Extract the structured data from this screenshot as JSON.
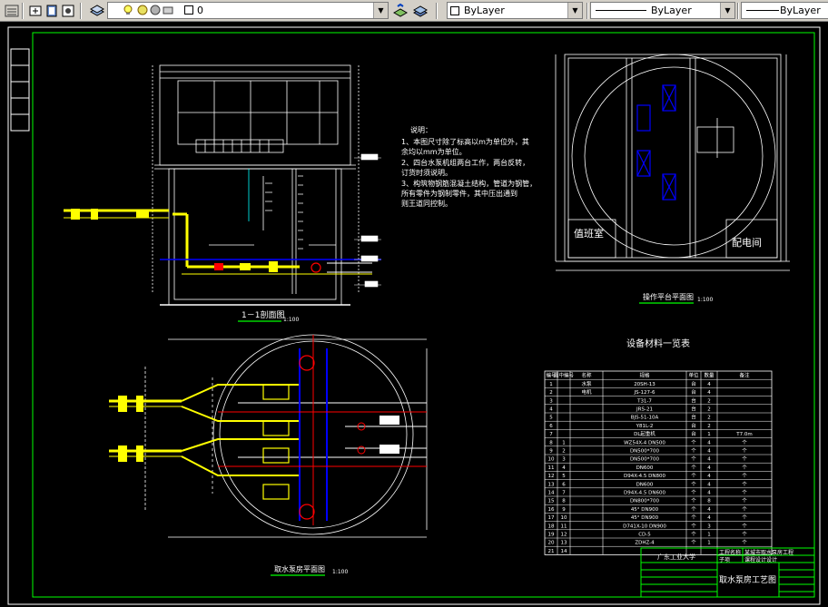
{
  "toolbar": {
    "layer_value": "0",
    "color_value": "ByLayer",
    "linetype_value": "ByLayer",
    "lineweight_value": "ByLayer",
    "icons": [
      "layer-manager-icon",
      "layer-previous-icon",
      "layers-icon",
      "lightbulb-icon",
      "sun-icon",
      "lock-icon",
      "make-object-layer-current-icon",
      "layer-previous-icon",
      "color-swatch-icon"
    ]
  },
  "drawing": {
    "section_title": "1－1剖面图",
    "section_scale": "1:100",
    "plan_title": "取水泵房平面图",
    "plan_scale": "1:100",
    "platform_title": "操作平台平面图",
    "platform_scale": "1:100",
    "room_duty": "值班室",
    "room_power": "配电间",
    "notes_title": "说明：",
    "notes": [
      "1、本图尺寸除了标高以m为单位外，其",
      "   余均以mm为单位。",
      "2、四台水泵机组两台工作，两台反转，",
      "   订货时须说明。",
      "3、构筑物钢筋混凝土结构，管道为钢管，",
      "   所有零件为钢制零件，其中压出通到",
      "   则王道同控制。"
    ],
    "table_title": "设备材料一览表",
    "table_headers": [
      "编号",
      "图中编号",
      "名称",
      "规格",
      "单位",
      "数量",
      "备注"
    ],
    "table_rows": [
      {
        "no": "1",
        "ref": "",
        "name": "水泵",
        "spec": "20SH-13",
        "unit": "台",
        "qty": "4",
        "note": ""
      },
      {
        "no": "2",
        "ref": "",
        "name": "电机",
        "spec": "JS-127-6",
        "unit": "台",
        "qty": "4",
        "note": ""
      },
      {
        "no": "3",
        "ref": "",
        "name": "",
        "spec": "T31-7",
        "unit": "台",
        "qty": "2",
        "note": ""
      },
      {
        "no": "4",
        "ref": "",
        "name": "",
        "spec": "JRS-21",
        "unit": "台",
        "qty": "2",
        "note": ""
      },
      {
        "no": "5",
        "ref": "",
        "name": "",
        "spec": "BJS-51-10A",
        "unit": "台",
        "qty": "2",
        "note": ""
      },
      {
        "no": "6",
        "ref": "",
        "name": "",
        "spec": "Y81L-2",
        "unit": "台",
        "qty": "2",
        "note": ""
      },
      {
        "no": "7",
        "ref": "",
        "name": "",
        "spec": "DL起重机",
        "unit": "台",
        "qty": "1",
        "note": "T7.0m"
      },
      {
        "no": "8",
        "ref": "1",
        "name": "",
        "spec": "WZ54X-4 DN500",
        "unit": "个",
        "qty": "4",
        "note": "个"
      },
      {
        "no": "9",
        "ref": "2",
        "name": "",
        "spec": "DN500*700",
        "unit": "个",
        "qty": "4",
        "note": "个"
      },
      {
        "no": "10",
        "ref": "3",
        "name": "",
        "spec": "DN500*700",
        "unit": "个",
        "qty": "4",
        "note": "个"
      },
      {
        "no": "11",
        "ref": "4",
        "name": "",
        "spec": "DN600",
        "unit": "个",
        "qty": "4",
        "note": "个"
      },
      {
        "no": "12",
        "ref": "5",
        "name": "",
        "spec": "D94X-4.5 DN800",
        "unit": "个",
        "qty": "4",
        "note": "个"
      },
      {
        "no": "13",
        "ref": "6",
        "name": "",
        "spec": "DN600",
        "unit": "个",
        "qty": "4",
        "note": "个"
      },
      {
        "no": "14",
        "ref": "7",
        "name": "",
        "spec": "D94X-4.5 DN600",
        "unit": "个",
        "qty": "4",
        "note": "个"
      },
      {
        "no": "15",
        "ref": "8",
        "name": "",
        "spec": "DN800*700",
        "unit": "个",
        "qty": "8",
        "note": "个"
      },
      {
        "no": "16",
        "ref": "9",
        "name": "",
        "spec": "45° DN900",
        "unit": "个",
        "qty": "4",
        "note": "个"
      },
      {
        "no": "17",
        "ref": "10",
        "name": "",
        "spec": "45° DN900",
        "unit": "个",
        "qty": "4",
        "note": "个"
      },
      {
        "no": "18",
        "ref": "11",
        "name": "",
        "spec": "D741X-10 DN900",
        "unit": "个",
        "qty": "3",
        "note": "个"
      },
      {
        "no": "19",
        "ref": "12",
        "name": "",
        "spec": "CD-5",
        "unit": "个",
        "qty": "1",
        "note": "个"
      },
      {
        "no": "20",
        "ref": "13",
        "name": "",
        "spec": "ZDHZ-4",
        "unit": "个",
        "qty": "1",
        "note": "个"
      },
      {
        "no": "21",
        "ref": "14",
        "name": "",
        "spec": "",
        "unit": "",
        "qty": "",
        "note": ""
      }
    ],
    "title_block": {
      "school": "广东工业大学",
      "project_label": "工程名称",
      "project_value": "某城市取水泵房工程",
      "item_label": "子项",
      "item_value": "课程设计设计",
      "drawing_name": "取水泵房工艺图"
    }
  },
  "colors": {
    "background": "#000000",
    "border": "#00ff00",
    "lines": "#ffffff",
    "pipe": "#ffff00",
    "accent_blue": "#0000ff",
    "accent_red": "#ff0000",
    "accent_cyan": "#00ffff"
  }
}
